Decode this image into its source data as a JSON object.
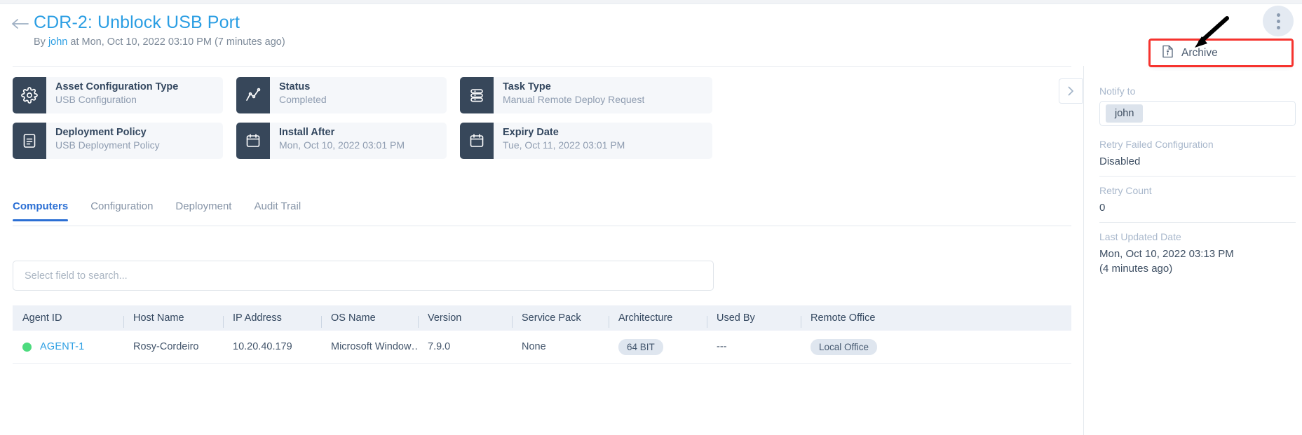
{
  "header": {
    "back_icon": "arrow-left-icon",
    "title": "CDR-2: Unblock USB Port",
    "subtitle_prefix": "By ",
    "subtitle_user": "john",
    "subtitle_suffix": " at Mon, Oct 10, 2022 03:10 PM (7 minutes ago)"
  },
  "actions": {
    "kebab_icon": "more-vertical-icon",
    "menu": [
      {
        "label": "Archive",
        "icon": "archive-file-icon"
      }
    ],
    "highlight_color": "#f6332e"
  },
  "cards": [
    {
      "icon": "gear-icon",
      "label": "Asset Configuration Type",
      "value": "USB Configuration"
    },
    {
      "icon": "line-chart-icon",
      "label": "Status",
      "value": "Completed"
    },
    {
      "icon": "server-rows-icon",
      "label": "Task Type",
      "value": "Manual Remote Deploy Request"
    },
    {
      "icon": "document-icon",
      "label": "Deployment Policy",
      "value": "USB Deployment Policy"
    },
    {
      "icon": "calendar-icon",
      "label": "Install After",
      "value": "Mon, Oct 10, 2022 03:01 PM"
    },
    {
      "icon": "calendar-icon",
      "label": "Expiry Date",
      "value": "Tue, Oct 11, 2022 03:01 PM"
    }
  ],
  "tabs": [
    {
      "label": "Computers",
      "active": true
    },
    {
      "label": "Configuration",
      "active": false
    },
    {
      "label": "Deployment",
      "active": false
    },
    {
      "label": "Audit Trail",
      "active": false
    }
  ],
  "search": {
    "placeholder": "Select field to search...",
    "value": ""
  },
  "table": {
    "columns": [
      "Agent ID",
      "Host Name",
      "IP Address",
      "OS Name",
      "Version",
      "Service Pack",
      "Architecture",
      "Used By",
      "Remote Office"
    ],
    "rows": [
      {
        "status_color": "#4ddb7e",
        "agent_id": "AGENT-1",
        "host_name": "Rosy-Cordeiro",
        "ip_address": "10.20.40.179",
        "os_name": "Microsoft Window…",
        "version": "7.9.0",
        "service_pack": "None",
        "architecture": "64 BIT",
        "used_by": "---",
        "remote_office": "Local Office"
      }
    ]
  },
  "collapse": {
    "icon": "chevron-right-icon"
  },
  "side_panel": {
    "notify_label": "Notify to",
    "notify_chip": "john",
    "retry_failed_label": "Retry Failed Configuration",
    "retry_failed_value": "Disabled",
    "retry_count_label": "Retry Count",
    "retry_count_value": "0",
    "last_updated_label": "Last Updated Date",
    "last_updated_value": "Mon, Oct 10, 2022 03:13 PM",
    "last_updated_rel": "(4 minutes ago)"
  }
}
